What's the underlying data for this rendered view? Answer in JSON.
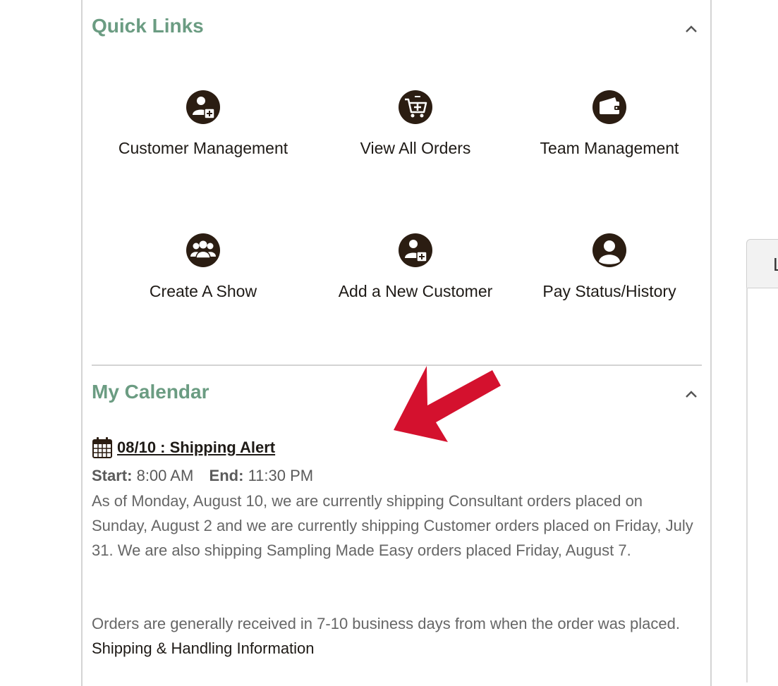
{
  "quick_links": {
    "title": "Quick Links",
    "items": [
      {
        "label": "Customer Management",
        "icon": "user-add-icon"
      },
      {
        "label": "View All Orders",
        "icon": "cart-icon"
      },
      {
        "label": "Team Management",
        "icon": "wallet-icon"
      },
      {
        "label": "Create A Show",
        "icon": "group-icon"
      },
      {
        "label": "Add a New Customer",
        "icon": "user-add-icon"
      },
      {
        "label": "Pay Status/History",
        "icon": "user-icon"
      }
    ]
  },
  "calendar": {
    "title": "My Calendar",
    "event": {
      "title": "08/10 : Shipping Alert",
      "start_label": "Start:",
      "start_time": "8:00 AM",
      "end_label": "End:",
      "end_time": "11:30 PM",
      "paragraph1": "As of Monday, August 10, we are currently shipping Consultant orders placed on Sunday, August 2 and we are currently shipping Customer orders placed on Friday, July 31. We are also shipping Sampling Made Easy orders placed Friday, August 7.",
      "paragraph2_text": "Orders are generally received in 7-10 business days from when the order was placed.",
      "paragraph2_link": "Shipping & Handling Information"
    }
  },
  "side_tab": {
    "label": "L"
  },
  "colors": {
    "accent": "#6b9c82",
    "icon_dark": "#2b1d12",
    "arrow_red": "#d4112e"
  }
}
